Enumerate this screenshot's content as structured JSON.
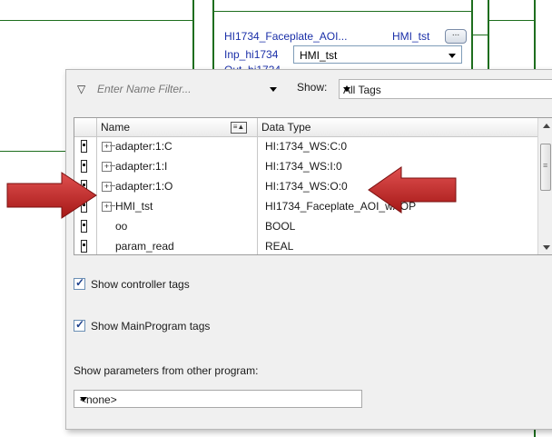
{
  "aoi": {
    "name_label": "HI1734_Faceplate_AOI...",
    "tag_label": "HMI_tst",
    "dots_label": "...",
    "inp_label": "Inp_hi1734",
    "out_label": "Out_hi1734",
    "selected_tag": "HMI_tst"
  },
  "filter": {
    "placeholder": "Enter Name Filter...",
    "show_label": "Show:",
    "show_value": "All Tags"
  },
  "grid": {
    "columns": [
      "Name",
      "Data Type"
    ],
    "rows": [
      {
        "name": "adapter:1:C",
        "type": "HI:1734_WS:C:0",
        "expandable": true
      },
      {
        "name": "adapter:1:I",
        "type": "HI:1734_WS:I:0",
        "expandable": true
      },
      {
        "name": "adapter:1:O",
        "type": "HI:1734_WS:O:0",
        "expandable": true
      },
      {
        "name": "HMI_tst",
        "type": "HI1734_Faceplate_AOI_wAOP",
        "expandable": true
      },
      {
        "name": "oo",
        "type": "BOOL",
        "expandable": false
      },
      {
        "name": "param_read",
        "type": "REAL",
        "expandable": false
      }
    ]
  },
  "options": {
    "show_controller_tags": "Show controller tags",
    "show_controller_tags_checked": true,
    "show_mainprogram_tags": "Show MainProgram tags",
    "show_mainprogram_tags_checked": true,
    "params_label": "Show parameters from other program:",
    "params_value": "<none>"
  },
  "colors": {
    "arrow": "#c0201e",
    "ladder_rail": "#1e6e1e",
    "aoi_text": "#1a2fa8"
  }
}
